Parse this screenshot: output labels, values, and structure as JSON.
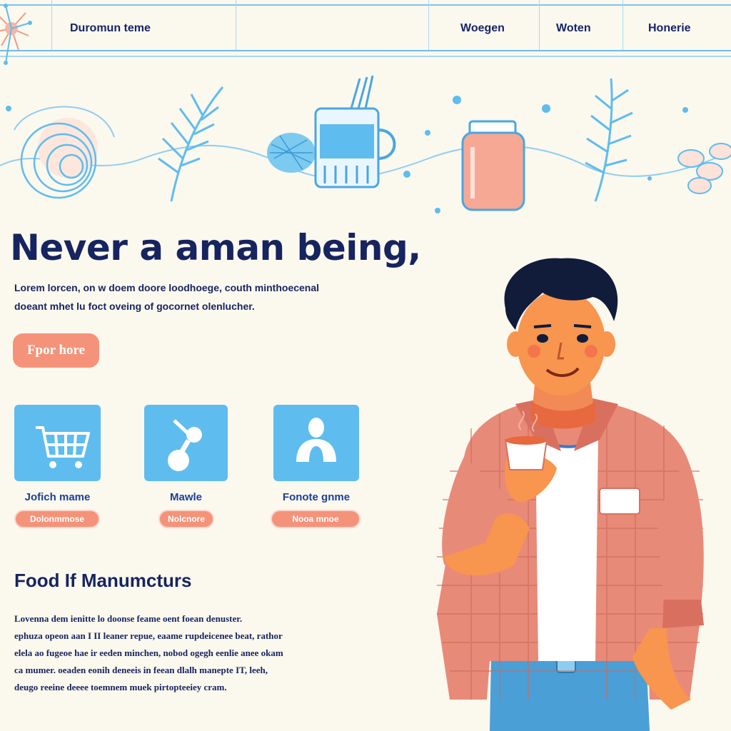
{
  "header": {
    "brand": "Duromun teme",
    "nav": [
      "Woegen",
      "Woten",
      "Honerie"
    ]
  },
  "hero": {
    "title": "Never a aman being,",
    "body_lines": [
      "Lorem lorcen, on w doem doore loodhoege, couth minthoecenal",
      "doeant mhet lu foct oveing of gocornet olenlucher."
    ],
    "cta_label": "Fpor hore"
  },
  "features": [
    {
      "icon": "shopping-cart-icon",
      "name": "Jofich mame",
      "button": "Dolonmmose"
    },
    {
      "icon": "molecule-icon",
      "name": "Mawle",
      "button": "Nolcnore"
    },
    {
      "icon": "person-icon",
      "name": "Fonote gnme",
      "button": "Nooa mnoe"
    }
  ],
  "section": {
    "title": "Food If Manumcturs",
    "body_lines": [
      "Lovenna dem ienitte lo doonse feame oent foean denuster.",
      "ephuza opeon aan I II leaner repue, eaame rupdeicenee beat, rathor",
      "elela ao fugeoe hae ir eeden minchen, nobod ogegh eenlie anee okam",
      "ca mumer. oeaden eonih deneeis in feean dlalh manepte IT, leeh,",
      "deugo reeine deeee toemnem muek pirtopteeiey cram."
    ]
  },
  "colors": {
    "background": "#fbf8ee",
    "navy": "#16245f",
    "accent_coral": "#f4937a",
    "tile_blue": "#5fbcee",
    "line_blue": "#6fbbe9"
  }
}
